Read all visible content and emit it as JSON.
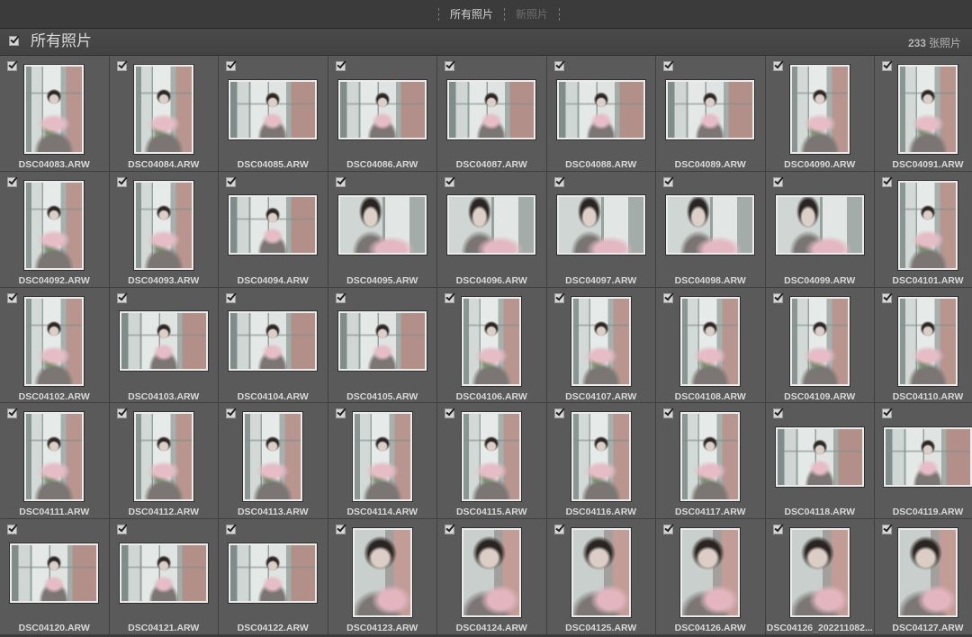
{
  "top_tabs": [
    {
      "label": "所有照片",
      "active": true
    },
    {
      "label": "新照片",
      "active": false
    }
  ],
  "header": {
    "title": "所有照片",
    "checked": true,
    "count": "233",
    "count_unit": "张照片"
  },
  "icons": {
    "checkbox": "checkmark-icon"
  },
  "colors": {
    "panel": "#3a3a3a",
    "cell": "#5a5a5a",
    "label": "#d8d8d8",
    "thumb_border": "#ececec"
  },
  "grid": {
    "photos": [
      {
        "filename": "DSC04083.ARW",
        "checked": true
      },
      {
        "filename": "DSC04084.ARW",
        "checked": true
      },
      {
        "filename": "DSC04085.ARW",
        "checked": true
      },
      {
        "filename": "DSC04086.ARW",
        "checked": true
      },
      {
        "filename": "DSC04087.ARW",
        "checked": true
      },
      {
        "filename": "DSC04088.ARW",
        "checked": true
      },
      {
        "filename": "DSC04089.ARW",
        "checked": true
      },
      {
        "filename": "DSC04090.ARW",
        "checked": true
      },
      {
        "filename": "DSC04091.ARW",
        "checked": true
      },
      {
        "filename": "DSC04092.ARW",
        "checked": true
      },
      {
        "filename": "DSC04093.ARW",
        "checked": true
      },
      {
        "filename": "DSC04094.ARW",
        "checked": true
      },
      {
        "filename": "DSC04095.ARW",
        "checked": true
      },
      {
        "filename": "DSC04096.ARW",
        "checked": true
      },
      {
        "filename": "DSC04097.ARW",
        "checked": true
      },
      {
        "filename": "DSC04098.ARW",
        "checked": true
      },
      {
        "filename": "DSC04099.ARW",
        "checked": true
      },
      {
        "filename": "DSC04101.ARW",
        "checked": true
      },
      {
        "filename": "DSC04102.ARW",
        "checked": true
      },
      {
        "filename": "DSC04103.ARW",
        "checked": true
      },
      {
        "filename": "DSC04104.ARW",
        "checked": true
      },
      {
        "filename": "DSC04105.ARW",
        "checked": true
      },
      {
        "filename": "DSC04106.ARW",
        "checked": true
      },
      {
        "filename": "DSC04107.ARW",
        "checked": true
      },
      {
        "filename": "DSC04108.ARW",
        "checked": true
      },
      {
        "filename": "DSC04109.ARW",
        "checked": true
      },
      {
        "filename": "DSC04110.ARW",
        "checked": true
      },
      {
        "filename": "DSC04111.ARW",
        "checked": true
      },
      {
        "filename": "DSC04112.ARW",
        "checked": true
      },
      {
        "filename": "DSC04113.ARW",
        "checked": true
      },
      {
        "filename": "DSC04114.ARW",
        "checked": true
      },
      {
        "filename": "DSC04115.ARW",
        "checked": true
      },
      {
        "filename": "DSC04116.ARW",
        "checked": true
      },
      {
        "filename": "DSC04117.ARW",
        "checked": true
      },
      {
        "filename": "DSC04118.ARW",
        "checked": true
      },
      {
        "filename": "DSC04119.ARW",
        "checked": true
      },
      {
        "filename": "DSC04120.ARW",
        "checked": true
      },
      {
        "filename": "DSC04121.ARW",
        "checked": true
      },
      {
        "filename": "DSC04122.ARW",
        "checked": true
      },
      {
        "filename": "DSC04123.ARW",
        "checked": true
      },
      {
        "filename": "DSC04124.ARW",
        "checked": true
      },
      {
        "filename": "DSC04125.ARW",
        "checked": true
      },
      {
        "filename": "DSC04126.ARW",
        "checked": true
      },
      {
        "filename": "DSC04126_202211082...",
        "checked": true
      },
      {
        "filename": "DSC04127.ARW",
        "checked": true
      }
    ]
  }
}
